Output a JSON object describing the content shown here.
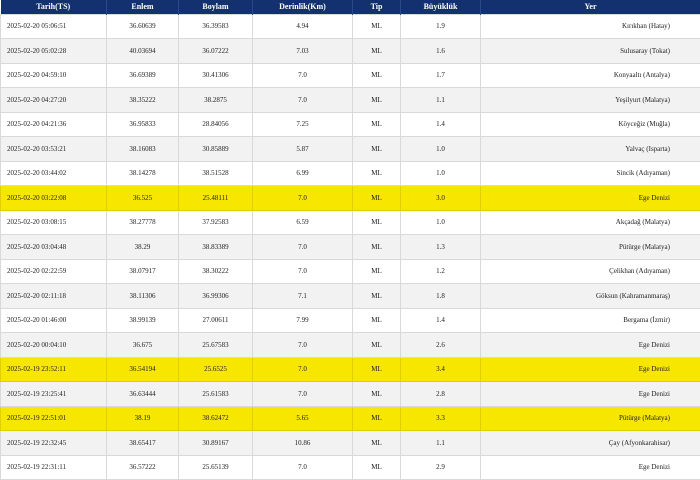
{
  "headers": {
    "date": "Tarih(TS)",
    "lat": "Enlem",
    "lon": "Boylam",
    "depth": "Derinlik(Km)",
    "type": "Tip",
    "mag": "Büyüklük",
    "place": "Yer"
  },
  "highlight_color": "#f7e600",
  "header_color": "#13316e",
  "rows": [
    {
      "date": "2025-02-20 05:06:51",
      "lat": "36.60639",
      "lon": "36.39583",
      "depth": "4.94",
      "type": "ML",
      "mag": "1.9",
      "place": "Kırıkhan (Hatay)",
      "highlight": false
    },
    {
      "date": "2025-02-20 05:02:28",
      "lat": "40.03694",
      "lon": "36.07222",
      "depth": "7.03",
      "type": "ML",
      "mag": "1.6",
      "place": "Sulusaray (Tokat)",
      "highlight": false
    },
    {
      "date": "2025-02-20 04:59:10",
      "lat": "36.69389",
      "lon": "30.41306",
      "depth": "7.0",
      "type": "ML",
      "mag": "1.7",
      "place": "Konyaaltı (Antalya)",
      "highlight": false
    },
    {
      "date": "2025-02-20 04:27:20",
      "lat": "38.35222",
      "lon": "38.2875",
      "depth": "7.0",
      "type": "ML",
      "mag": "1.1",
      "place": "Yeşilyurt (Malatya)",
      "highlight": false
    },
    {
      "date": "2025-02-20 04:21:36",
      "lat": "36.95833",
      "lon": "28.84056",
      "depth": "7.25",
      "type": "ML",
      "mag": "1.4",
      "place": "Köyceğiz (Muğla)",
      "highlight": false
    },
    {
      "date": "2025-02-20 03:53:21",
      "lat": "38.16083",
      "lon": "30.85889",
      "depth": "5.87",
      "type": "ML",
      "mag": "1.0",
      "place": "Yalvaç (Isparta)",
      "highlight": false
    },
    {
      "date": "2025-02-20 03:44:02",
      "lat": "38.14278",
      "lon": "38.51528",
      "depth": "6.99",
      "type": "ML",
      "mag": "1.0",
      "place": "Sincik (Adıyaman)",
      "highlight": false
    },
    {
      "date": "2025-02-20 03:22:08",
      "lat": "36.525",
      "lon": "25.48111",
      "depth": "7.0",
      "type": "ML",
      "mag": "3.0",
      "place": "Ege Denizi",
      "highlight": true
    },
    {
      "date": "2025-02-20 03:08:15",
      "lat": "38.27778",
      "lon": "37.92583",
      "depth": "6.59",
      "type": "ML",
      "mag": "1.0",
      "place": "Akçadağ (Malatya)",
      "highlight": false
    },
    {
      "date": "2025-02-20 03:04:48",
      "lat": "38.29",
      "lon": "38.83389",
      "depth": "7.0",
      "type": "ML",
      "mag": "1.3",
      "place": "Pütürge (Malatya)",
      "highlight": false
    },
    {
      "date": "2025-02-20 02:22:59",
      "lat": "38.07917",
      "lon": "38.30222",
      "depth": "7.0",
      "type": "ML",
      "mag": "1.2",
      "place": "Çelikhan (Adıyaman)",
      "highlight": false
    },
    {
      "date": "2025-02-20 02:11:18",
      "lat": "38.11306",
      "lon": "36.99306",
      "depth": "7.1",
      "type": "ML",
      "mag": "1.8",
      "place": "Göksun (Kahramanmaraş)",
      "highlight": false
    },
    {
      "date": "2025-02-20 01:46:00",
      "lat": "38.99139",
      "lon": "27.00611",
      "depth": "7.99",
      "type": "ML",
      "mag": "1.4",
      "place": "Bergama (İzmir)",
      "highlight": false
    },
    {
      "date": "2025-02-20 00:04:10",
      "lat": "36.675",
      "lon": "25.67583",
      "depth": "7.0",
      "type": "ML",
      "mag": "2.6",
      "place": "Ege Denizi",
      "highlight": false
    },
    {
      "date": "2025-02-19 23:52:11",
      "lat": "36.54194",
      "lon": "25.6525",
      "depth": "7.0",
      "type": "ML",
      "mag": "3.4",
      "place": "Ege Denizi",
      "highlight": true
    },
    {
      "date": "2025-02-19 23:25:41",
      "lat": "36.63444",
      "lon": "25.61583",
      "depth": "7.0",
      "type": "ML",
      "mag": "2.8",
      "place": "Ege Denizi",
      "highlight": false
    },
    {
      "date": "2025-02-19 22:51:01",
      "lat": "38.19",
      "lon": "38.62472",
      "depth": "5.65",
      "type": "ML",
      "mag": "3.3",
      "place": "Pütürge (Malatya)",
      "highlight": true
    },
    {
      "date": "2025-02-19 22:32:45",
      "lat": "38.65417",
      "lon": "30.89167",
      "depth": "10.86",
      "type": "ML",
      "mag": "1.1",
      "place": "Çay (Afyonkarahisar)",
      "highlight": false
    },
    {
      "date": "2025-02-19 22:31:11",
      "lat": "36.57222",
      "lon": "25.65139",
      "depth": "7.0",
      "type": "ML",
      "mag": "2.9",
      "place": "Ege Denizi",
      "highlight": false
    }
  ]
}
